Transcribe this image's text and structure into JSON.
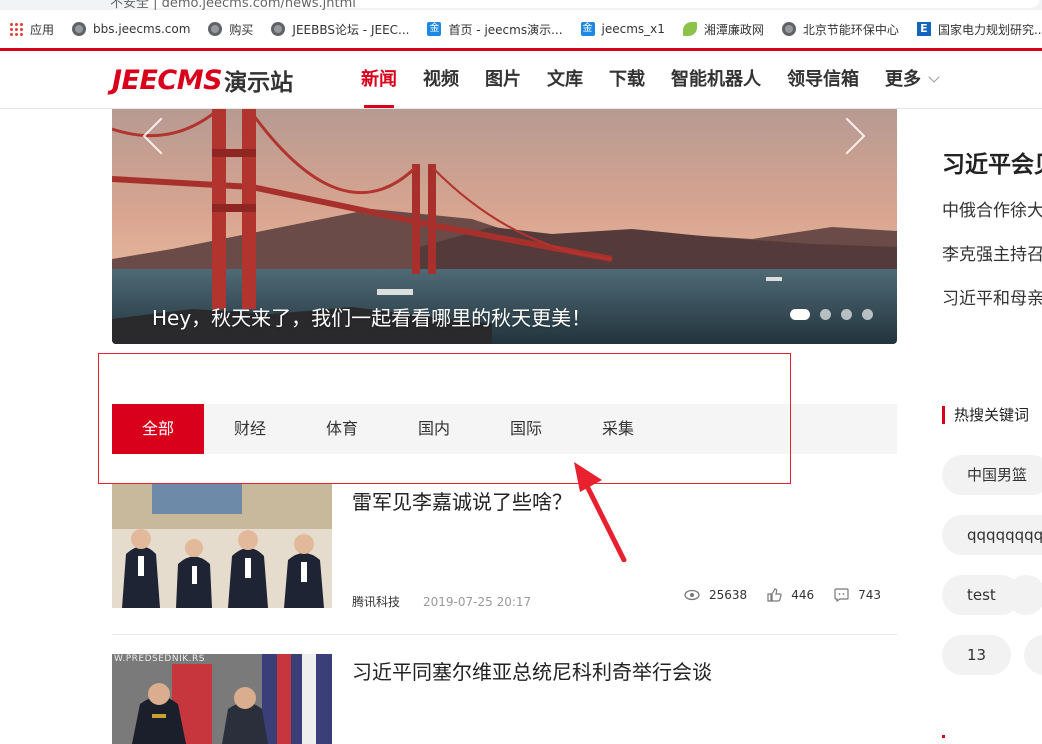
{
  "browser": {
    "address_fragment": "不安全 | demo.jeecms.com/news.jhtml",
    "bookmarks": [
      {
        "label": "应用",
        "icon": "apps-grid-icon"
      },
      {
        "label": "bbs.jeecms.com",
        "icon": "globe-icon"
      },
      {
        "label": "购买",
        "icon": "globe-icon"
      },
      {
        "label": "JEEBBS论坛 - JEEC...",
        "icon": "globe-icon"
      },
      {
        "label": "首页 - jeecms演示...",
        "icon": "jin-icon"
      },
      {
        "label": "jeecms_x1",
        "icon": "jin-icon"
      },
      {
        "label": "湘潭廉政网",
        "icon": "leaf-icon"
      },
      {
        "label": "北京节能环保中心",
        "icon": "globe-icon"
      },
      {
        "label": "国家电力规划研究...",
        "icon": "e-icon"
      }
    ],
    "jin_glyph": "金",
    "e_glyph": "E"
  },
  "site": {
    "logo_brand": "JEECMS",
    "logo_sub": "演示站",
    "nav": [
      "新闻",
      "视频",
      "图片",
      "文库",
      "下载",
      "智能机器人",
      "领导信箱"
    ],
    "nav_more": "更多",
    "accent": "#d9001b"
  },
  "banner": {
    "caption": "Hey，秋天来了，我们一起看看哪里的秋天更美！",
    "dots": 4,
    "active_dot": 1
  },
  "tabs": {
    "items": [
      "全部",
      "财经",
      "体育",
      "国内",
      "国际",
      "采集"
    ],
    "active": 0
  },
  "news": [
    {
      "title": "雷军见李嘉诚说了些啥？",
      "source": "腾讯科技",
      "date": "2019-07-25 20:17",
      "views": "25638",
      "likes": "446",
      "comments": "743"
    },
    {
      "title": "习近平同塞尔维亚总统尼科利奇举行会谈",
      "thumb_text": "W.PREDSEDNIK.RS"
    }
  ],
  "sidebar": {
    "headline": "习近平会见",
    "links": [
      "中俄合作徐大",
      "李克强主持召",
      "习近平和母亲"
    ],
    "hot_title": "热搜关键词",
    "keywords": [
      "中国男篮",
      "qqqqqqqq",
      "test",
      "13"
    ]
  }
}
